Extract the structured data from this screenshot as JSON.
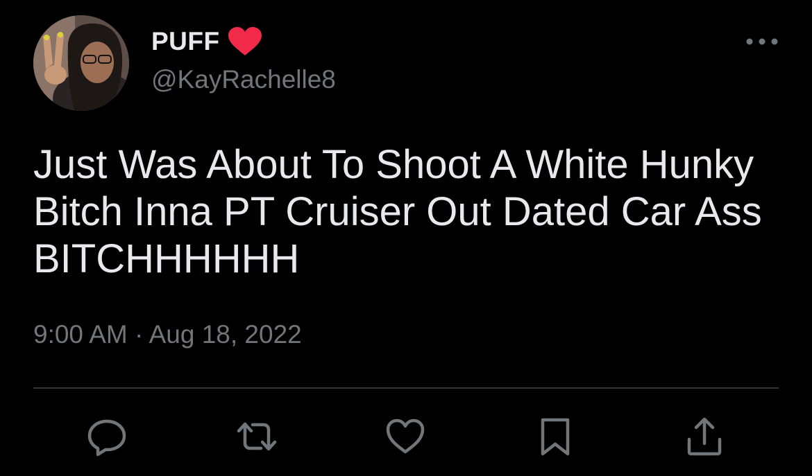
{
  "user": {
    "display_name": "PUFF",
    "display_name_emoji": "red-heart-emoji",
    "handle": "@KayRachelle8"
  },
  "tweet": {
    "text": "Just Was About To Shoot A White Hunky Bitch Inna PT Cruiser Out Dated Car Ass BITCHHHHHH",
    "timestamp": "9:00 AM · Aug 18, 2022"
  },
  "actions": [
    {
      "icon": "reply-icon"
    },
    {
      "icon": "retweet-icon"
    },
    {
      "icon": "like-icon"
    },
    {
      "icon": "bookmark-icon"
    },
    {
      "icon": "share-icon"
    }
  ],
  "colors": {
    "background": "#000000",
    "primary_text": "#e7e9ea",
    "secondary_text": "#71767b",
    "divider": "#2f3336",
    "heart": "#f91880"
  }
}
